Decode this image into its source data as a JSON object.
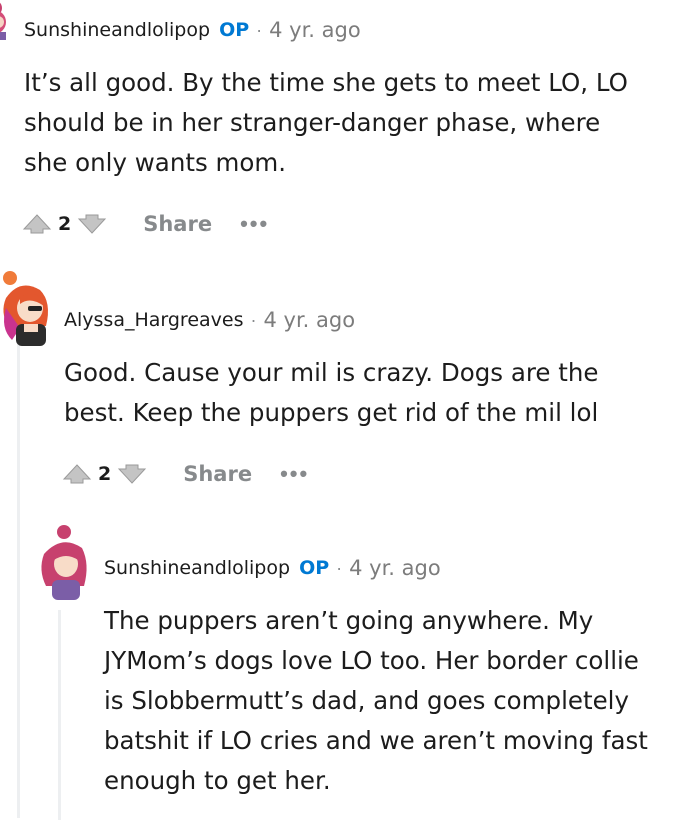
{
  "comments": [
    {
      "username": "Sunshineandlolipop",
      "op_badge": "OP",
      "separator": "·",
      "timestamp": "4 yr. ago",
      "lines": [
        "It’s all good. By the time she gets to meet LO, LO",
        "should be in her stranger-danger phase, where",
        "she only wants mom."
      ],
      "score": "2",
      "share_label": "Share",
      "more_label": "•••"
    },
    {
      "username": "Alyssa_Hargreaves",
      "separator": "·",
      "timestamp": "4 yr. ago",
      "lines": [
        "Good. Cause your mil is crazy. Dogs are the",
        "best. Keep the puppers get rid of the mil lol"
      ],
      "score": "2",
      "share_label": "Share",
      "more_label": "•••"
    },
    {
      "username": "Sunshineandlolipop",
      "op_badge": "OP",
      "separator": "·",
      "timestamp": "4 yr. ago",
      "lines": [
        "The puppers aren’t going anywhere. My",
        "JYMom’s dogs love LO too. Her border collie",
        "is Slobbermutt’s dad, and goes completely",
        "batshit if LO cries and we aren’t moving fast",
        "enough to get her."
      ]
    }
  ],
  "colors": {
    "op_blue": "#0079d3",
    "meta_gray": "#878a8c",
    "text": "#1c1c1c",
    "thread_line": "#edeff1"
  },
  "icons": {
    "upvote": "upvote-icon",
    "downvote": "downvote-icon",
    "more": "more-options-icon",
    "avatar": "avatar-icon"
  }
}
